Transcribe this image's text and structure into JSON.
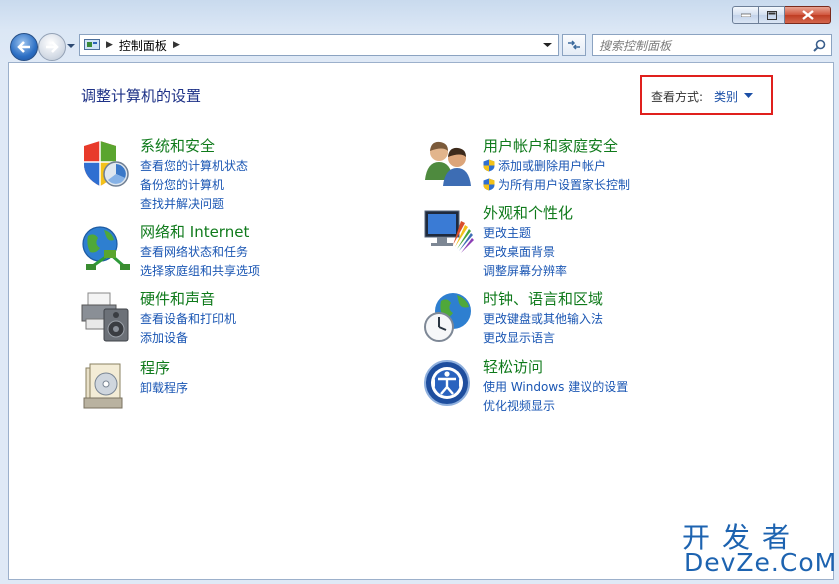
{
  "window": {
    "minimize_label": "",
    "maximize_label": "",
    "close_label": ""
  },
  "address": {
    "breadcrumb": "控制面板"
  },
  "search": {
    "placeholder": "搜索控制面板"
  },
  "content": {
    "title": "调整计算机的设置",
    "view_by_label": "查看方式:",
    "view_by_value": "类别"
  },
  "categories": [
    {
      "title": "系统和安全",
      "icon": "system-security-icon",
      "links": [
        "查看您的计算机状态",
        "备份您的计算机",
        "查找并解决问题"
      ]
    },
    {
      "title": "网络和 Internet",
      "icon": "network-globe-icon",
      "links": [
        "查看网络状态和任务",
        "选择家庭组和共享选项"
      ]
    },
    {
      "title": "硬件和声音",
      "icon": "printer-speaker-icon",
      "links": [
        "查看设备和打印机",
        "添加设备"
      ]
    },
    {
      "title": "程序",
      "icon": "programs-icon",
      "links": [
        "卸载程序"
      ]
    },
    {
      "title": "用户帐户和家庭安全",
      "icon": "users-icon",
      "links": [
        "添加或删除用户帐户",
        "为所有用户设置家长控制"
      ]
    },
    {
      "title": "外观和个性化",
      "icon": "monitor-appearance-icon",
      "links": [
        "更改主题",
        "更改桌面背景",
        "调整屏幕分辨率"
      ]
    },
    {
      "title": "时钟、语言和区域",
      "icon": "clock-globe-icon",
      "links": [
        "更改键盘或其他输入法",
        "更改显示语言"
      ]
    },
    {
      "title": "轻松访问",
      "icon": "ease-of-access-icon",
      "links": [
        "使用 Windows 建议的设置",
        "优化视频显示"
      ]
    }
  ],
  "watermark": {
    "line1": "开发者",
    "line2": "DevZe.CoM"
  }
}
